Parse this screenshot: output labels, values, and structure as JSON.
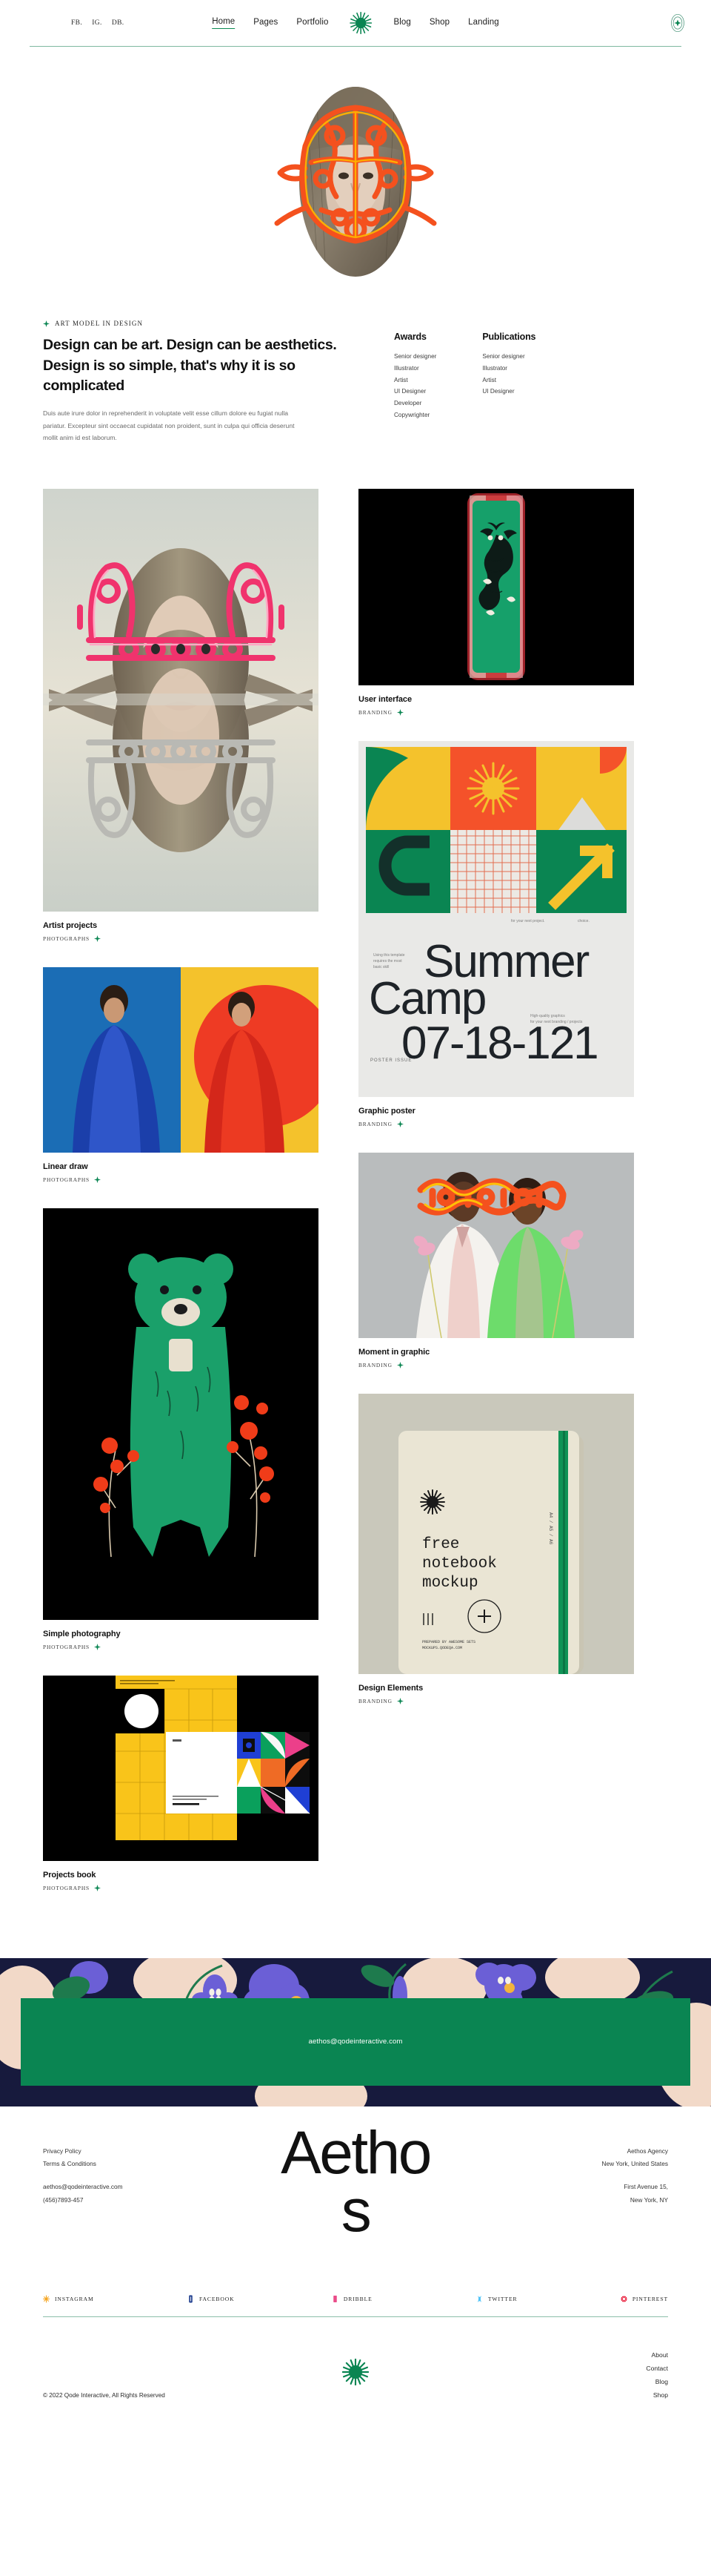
{
  "header": {
    "social_links": [
      {
        "label": "FB."
      },
      {
        "label": "IG."
      },
      {
        "label": "DB."
      }
    ],
    "nav_left": [
      {
        "label": "Home",
        "active": true
      },
      {
        "label": "Pages",
        "active": false
      },
      {
        "label": "Portfolio",
        "active": false
      }
    ],
    "nav_right": [
      {
        "label": "Blog"
      },
      {
        "label": "Shop"
      },
      {
        "label": "Landing"
      }
    ],
    "logo_icon": "starburst-icon",
    "action_icon": "circle-star-icon"
  },
  "hero": {
    "image_alt": "portrait with orange ornamental mask"
  },
  "intro": {
    "eyebrow": "ART MODEL IN DESIGN",
    "eyebrow_icon": "star-icon",
    "headline": "Design can be art. Design can be aesthetics. Design is so simple, that's why it is so complicated",
    "body": "Duis aute irure dolor in reprehenderit in voluptate velit esse cillum dolore eu fugiat nulla pariatur. Excepteur sint occaecat cupidatat non proident, sunt in culpa qui officia deserunt mollit anim id est laborum.",
    "awards": {
      "title": "Awards",
      "items": [
        "Senior designer",
        "Illustrator",
        "Artist",
        "UI Designer",
        "Developer",
        "Copywrighter"
      ]
    },
    "publications": {
      "title": "Publications",
      "items": [
        "Senior designer",
        "Illustrator",
        "Artist",
        "UI Designer"
      ]
    }
  },
  "portfolio": {
    "left_column": [
      {
        "title": "Artist projects",
        "category": "PHOTOGRAPHS",
        "media": "portrait-mirror-pink-ornament"
      },
      {
        "title": "Linear draw",
        "category": "PHOTOGRAPHS",
        "media": "two-models-blue-red-coats"
      },
      {
        "title": "Simple photography",
        "category": "PHOTOGRAPHS",
        "media": "green-bear-illustration"
      },
      {
        "title": "Projects book",
        "category": "PHOTOGRAPHS",
        "media": "yellow-grid-stationery"
      }
    ],
    "right_column": [
      {
        "title": "User interface",
        "category": "BRANDING",
        "media": "green-phone-tiger-app"
      },
      {
        "title": "Graphic poster",
        "category": "BRANDING",
        "media": "summer-camp-poster"
      },
      {
        "title": "Moment in graphic",
        "category": "BRANDING",
        "media": "two-men-suits-orange-glasses"
      },
      {
        "title": "Design Elements",
        "category": "BRANDING",
        "media": "free-notebook-mockup"
      }
    ],
    "poster": {
      "line1": "Summer",
      "line2": "Camp",
      "line3": "07-18-121",
      "label": "POSTER ISSUE",
      "note_left": "Using this template requires the most basic skill",
      "note_right": "High-quality graphics for your next branding / projects"
    },
    "notebook": {
      "line1": "free",
      "line2": "notebook",
      "line3": "mockup",
      "side": "A4 / A5 / A6",
      "footer1": "PREPARED BY AWESOME SETS",
      "footer2": "MOCKUPS.QODEQA.COM"
    }
  },
  "banner": {
    "email": "aethos@qodeinteractive.com"
  },
  "footer": {
    "bigword": "Aethos",
    "left_links": [
      "Privacy Policy",
      "Terms & Conditions"
    ],
    "left_contact": [
      "aethos@qodeinteractive.com",
      "(456)7893-457"
    ],
    "right_company": [
      "Aethos Agency",
      "New York, United States"
    ],
    "right_address": [
      "First Avenue 15,",
      "New York, NY"
    ],
    "socials": [
      {
        "label": "INSTAGRAM",
        "color": "#F5A623",
        "icon": "instagram-icon"
      },
      {
        "label": "FACEBOOK",
        "color": "#1B3A8C",
        "icon": "facebook-icon"
      },
      {
        "label": "DRIBBLE",
        "color": "#EA4C89",
        "icon": "dribbble-icon"
      },
      {
        "label": "TWITTER",
        "color": "#4FC3F7",
        "icon": "twitter-icon"
      },
      {
        "label": "PINTEREST",
        "color": "#E60023",
        "icon": "pinterest-icon"
      }
    ],
    "copyright": "© 2022 Qode Interactive, All Rights Reserved",
    "bottom_links": [
      "About",
      "Contact",
      "Blog",
      "Shop"
    ],
    "logo_icon": "starburst-icon"
  },
  "colors": {
    "green": "#0a8552",
    "rule": "#7fb8a0",
    "text": "#1c1c1c"
  }
}
